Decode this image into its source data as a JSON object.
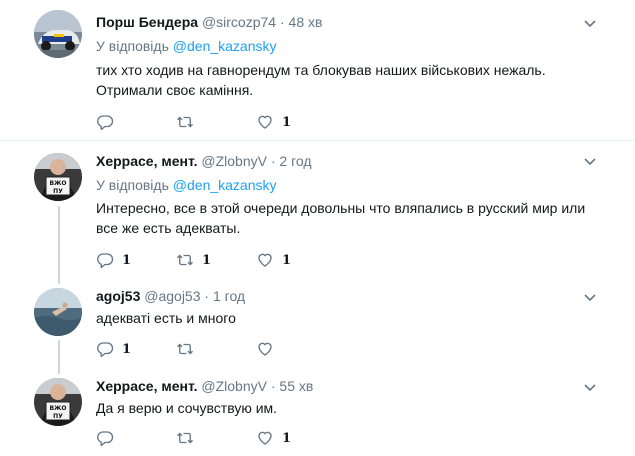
{
  "tweets": [
    {
      "name": "Порш Бендера",
      "handle": "@sircozp74",
      "dot": "·",
      "time": "48 хв",
      "reply_prefix": "У відповідь",
      "reply_to": "@den_kazansky",
      "text": "тих хто ходив на гавнорендум та блокував наших військових нежаль. Отримали своє каміння.",
      "actions": {
        "reply_count": "",
        "retweet_count": "",
        "like_count": "1"
      }
    },
    {
      "name": "Херрасе, мент.",
      "handle": "@ZlobnyV",
      "dot": "·",
      "time": "2 год",
      "reply_prefix": "У відповідь",
      "reply_to": "@den_kazansky",
      "text": "Интересно, все в этой очереди довольны что вляпались в русский мир или все же есть адекваты.",
      "avatar_sign_line1": "ВЖО",
      "avatar_sign_line2": "ПУ",
      "actions": {
        "reply_count": "1",
        "retweet_count": "1",
        "like_count": "1"
      }
    },
    {
      "name": "agoj53",
      "handle": "@agoj53",
      "dot": "·",
      "time": "1 год",
      "text": "адекваті есть и много",
      "actions": {
        "reply_count": "1",
        "retweet_count": "",
        "like_count": ""
      }
    },
    {
      "name": "Херрасе, мент.",
      "handle": "@ZlobnyV",
      "dot": "·",
      "time": "55 хв",
      "text": "Да я верю и сочувствую им.",
      "avatar_sign_line1": "ВЖО",
      "avatar_sign_line2": "ПУ",
      "actions": {
        "reply_count": "",
        "retweet_count": "",
        "like_count": "1"
      }
    }
  ],
  "colors": {
    "name": "#14171a",
    "muted": "#657786",
    "link": "#1da1f2",
    "divider": "#e6ecf0",
    "thread_line": "#ccd6dd"
  }
}
